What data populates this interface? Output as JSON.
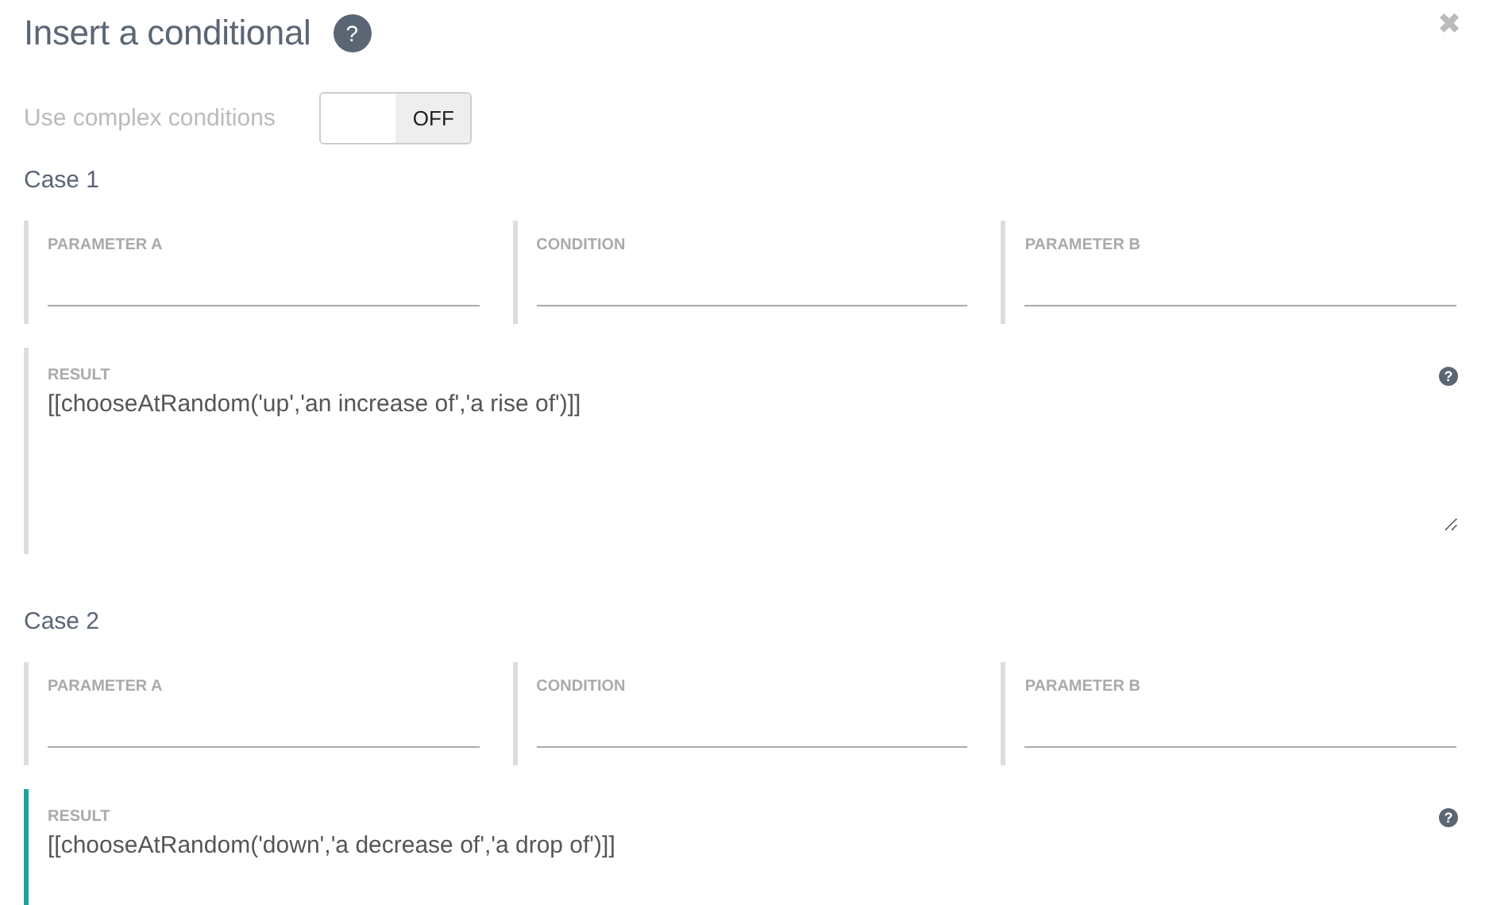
{
  "dialog": {
    "title": "Insert a conditional",
    "help": "?",
    "close": "✖"
  },
  "complex_conditions": {
    "label": "Use complex conditions",
    "on": false,
    "state_text": "OFF"
  },
  "cases": [
    {
      "title": "Case 1",
      "fields": [
        {
          "label": "PARAMETER A"
        },
        {
          "label": "CONDITION"
        },
        {
          "label": "PARAMETER B"
        }
      ],
      "result": {
        "label": "RESULT",
        "value": "[[chooseAtRandom('up','an increase of','a rise of')]]",
        "focused": false
      }
    },
    {
      "title": "Case 2",
      "fields": [
        {
          "label": "PARAMETER A"
        },
        {
          "label": "CONDITION"
        },
        {
          "label": "PARAMETER B"
        }
      ],
      "result": {
        "label": "RESULT",
        "value": "[[chooseAtRandom('down','a decrease of','a drop of')]]",
        "focused": true
      }
    }
  ]
}
